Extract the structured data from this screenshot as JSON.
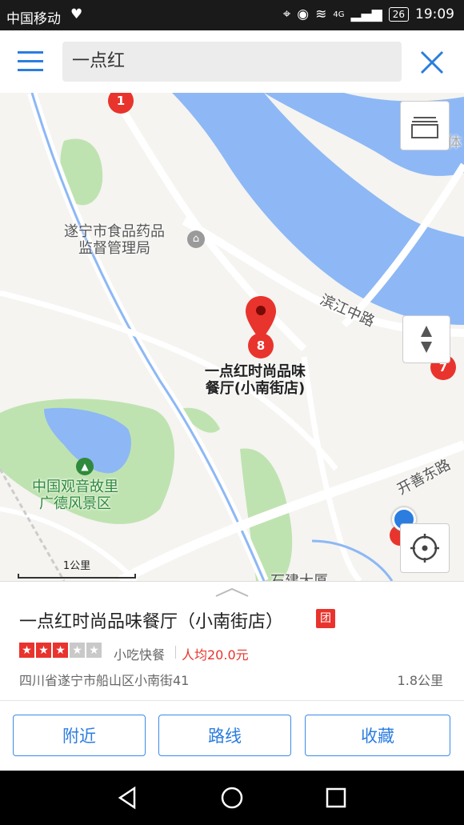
{
  "status_bar": {
    "carrier": "中国移动",
    "network": "4G",
    "battery": "26",
    "time": "19:09"
  },
  "search": {
    "query": "一点红"
  },
  "map": {
    "labels": {
      "food_bureau": "遂宁市食品药品\n监督管理局",
      "binjiang_road": "滨江中路",
      "poi_name": "一点红时尚品味\n餐厅(小南街店)",
      "scenic_area": "中国观音故里\n广德风景区",
      "kaishan_road": "开善东路",
      "partial_building": "石建大厦",
      "partial_top_right": "遂宁市体"
    },
    "markers": {
      "m1": "1",
      "m7": "7",
      "m8": "8"
    },
    "scale": "1公里"
  },
  "result": {
    "title": "一点红时尚品味餐厅（小南街店）",
    "tuan_badge": "团",
    "rating": 3,
    "rating_max": 5,
    "category": "小吃快餐",
    "price": "人均20.0元",
    "address": "四川省遂宁市船山区小南街41",
    "distance": "1.8公里"
  },
  "actions": {
    "nearby": "附近",
    "route": "路线",
    "favorite": "收藏"
  },
  "colors": {
    "accent": "#2b7de0",
    "marker_red": "#e8342d",
    "river": "#8db8f5",
    "park": "#bfe3b0"
  }
}
